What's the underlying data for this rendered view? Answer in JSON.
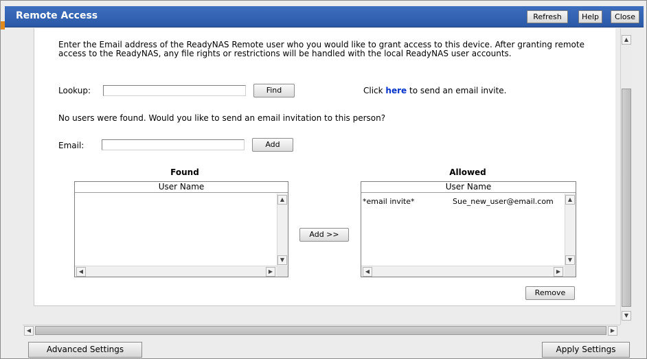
{
  "window": {
    "title": "Remote Access",
    "buttons": {
      "refresh": "Refresh",
      "help": "Help",
      "close": "Close"
    }
  },
  "intro_text": "Enter the Email address of the ReadyNAS Remote user who you would like to grant access to this device. After granting remote access to the ReadyNAS, any file rights or restrictions will be handled with the local ReadyNAS user accounts.",
  "lookup": {
    "label": "Lookup:",
    "value": "",
    "button": "Find"
  },
  "invite": {
    "prefix": "Click ",
    "link": "here",
    "suffix": " to send an email invite."
  },
  "no_users_message": "No users were found. Would you like to send an email invitation to this person?",
  "email": {
    "label": "Email:",
    "value": "",
    "button": "Add"
  },
  "found": {
    "title": "Found",
    "column": "User Name",
    "items": []
  },
  "add_to_allowed_button": "Add >>",
  "allowed": {
    "title": "Allowed",
    "column": "User Name",
    "items": [
      {
        "type": "*email invite*",
        "user": "Sue_new_user@email.com"
      }
    ],
    "remove_button": "Remove"
  },
  "footer": {
    "advanced_settings": "Advanced Settings",
    "apply_settings": "Apply Settings"
  },
  "colors": {
    "titlebar": "#2f5fb0",
    "link": "#0033cc",
    "accent": "#e08a1e"
  },
  "icons": {
    "scroll_up": "▲",
    "scroll_down": "▼",
    "scroll_left": "◀",
    "scroll_right": "▶"
  }
}
